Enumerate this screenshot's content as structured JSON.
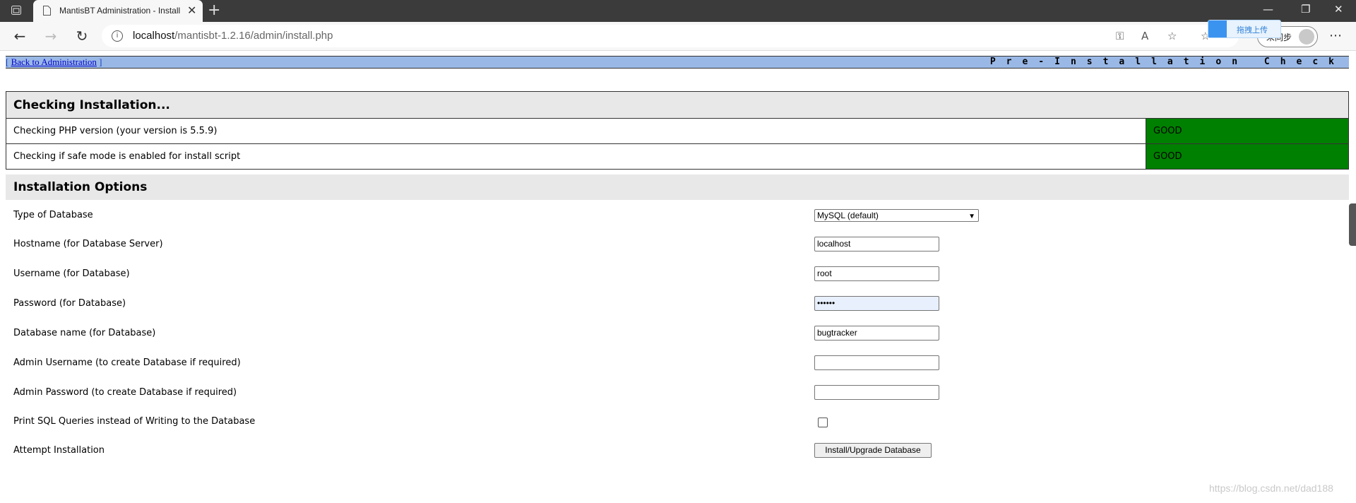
{
  "browser": {
    "tab_title": "MantisBT Administration - Install",
    "url_host": "localhost",
    "url_path": "/mantisbt-1.2.16/admin/install.php",
    "sync_label": "未同步",
    "upload_label": "拖拽上传"
  },
  "page": {
    "back_link": "Back to Administration",
    "back_open": "[ ",
    "back_close": " ]",
    "title_right": "Pre-Installation Check"
  },
  "checks": {
    "header": "Checking Installation...",
    "rows": [
      {
        "label": "Checking PHP version (your version is 5.5.9)",
        "status": "GOOD"
      },
      {
        "label": "Checking if safe mode is enabled for install script",
        "status": "GOOD"
      }
    ],
    "good_color": "#008000"
  },
  "options": {
    "header": "Installation Options",
    "db_type_label": "Type of Database",
    "db_type_value": "MySQL (default)",
    "hostname_label": "Hostname (for Database Server)",
    "hostname_value": "localhost",
    "username_label": "Username (for Database)",
    "username_value": "root",
    "password_label": "Password (for Database)",
    "password_value": "••••••",
    "dbname_label": "Database name (for Database)",
    "dbname_value": "bugtracker",
    "admin_user_label": "Admin Username (to create Database if required)",
    "admin_user_value": "",
    "admin_pass_label": "Admin Password (to create Database if required)",
    "admin_pass_value": "",
    "print_sql_label": "Print SQL Queries instead of Writing to the Database",
    "attempt_label": "Attempt Installation",
    "install_button": "Install/Upgrade Database"
  },
  "watermark": "https://blog.csdn.net/dad188"
}
